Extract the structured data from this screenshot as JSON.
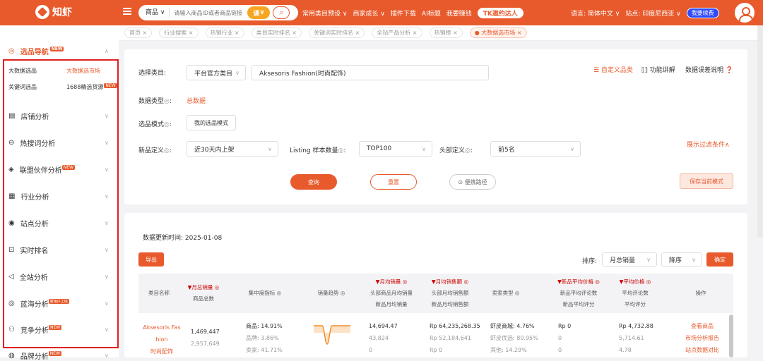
{
  "topbar": {
    "logo_text": "知虾",
    "search_type": "商品",
    "search_placeholder": "请输入商品ID或者商品链接",
    "lesson_badge": "课",
    "nav": [
      "常用类目预设 ∨",
      "商家成长 ∨",
      "插件下载",
      "AI标题",
      "我要赚钱"
    ],
    "tk_button": "TK邀约达人",
    "language": "语言: 简体中文 ∨",
    "site": "站点: 印度尼西亚 ∨",
    "renew": "我要续费"
  },
  "sidebar": {
    "section_title": "选品导航",
    "new_badge": "NEW",
    "hot_badge": "新用户上线",
    "sub_items": [
      {
        "label": "大数据选品",
        "highlight": false
      },
      {
        "label": "大数据选市场",
        "highlight": true
      },
      {
        "label": "关键词选品",
        "highlight": false
      },
      {
        "label": "1688精选货源",
        "highlight": false
      }
    ],
    "items": [
      {
        "label": "店铺分析",
        "icon": "store-icon",
        "badge": ""
      },
      {
        "label": "热搜词分析",
        "icon": "search-icon",
        "badge": ""
      },
      {
        "label": "联盟伙伴分析",
        "icon": "box-icon",
        "badge": "NEW"
      },
      {
        "label": "行业分析",
        "icon": "chart-icon",
        "badge": ""
      },
      {
        "label": "站点分析",
        "icon": "globe-icon",
        "badge": ""
      },
      {
        "label": "实时排名",
        "icon": "ranking-icon",
        "badge": ""
      },
      {
        "label": "全站分析",
        "icon": "send-icon",
        "badge": ""
      },
      {
        "label": "蓝海分析",
        "icon": "compass-icon",
        "badge": "新用户上线"
      },
      {
        "label": "竞争分析",
        "icon": "compete-icon",
        "badge": "NEW"
      },
      {
        "label": "品牌分析",
        "icon": "brand-icon",
        "badge": "NEW"
      }
    ]
  },
  "breadcrumbs": [
    "首页 ×",
    "行业搜索 ×",
    "热销行业 ×",
    "类目实时排名 ×",
    "关键词实时排名 ×",
    "全站产品分析 ×",
    "热销榜 ×",
    "● 大数据选市场 ×"
  ],
  "filters": {
    "category_label": "选择类目:",
    "category_source": "平台官方类目",
    "category_value": "Aksesoris Fashion(时尚配饰)",
    "custom_category": "☰ 自定义品类",
    "feature_guide": "功能讲解",
    "data_error_note": "数据误差说明",
    "data_type_label": "数据类型",
    "data_type_value": "总数据",
    "mode_label": "选品模式",
    "mode_value": "我的选品模式",
    "new_def_label": "新品定义",
    "new_def_value": "近30天内上架",
    "listing_label": "Listing 样本数量",
    "listing_value": "TOP100",
    "head_def_label": "头部定义",
    "head_def_value": "前5名",
    "show_filters": "展示过滤条件∧",
    "query_btn": "查询",
    "reset_btn": "重置",
    "path_btn": "便携路径",
    "save_btn": "保存当前模式"
  },
  "results": {
    "update_time": "数据更新时间: 2025-01-08",
    "export_btn": "导出",
    "sort_label": "排序:",
    "sort_by": "月总销量",
    "sort_order": "降序",
    "confirm_btn": "确定",
    "columns": [
      [
        "类目名称"
      ],
      [
        "▼月总销量 ◎",
        "商品总数"
      ],
      [
        "集中度指标 ◎"
      ],
      [
        "销量趋势 ◎"
      ],
      [
        "▼月均销量 ◎",
        "头部商品月均销量",
        "新品月均销量"
      ],
      [
        "▼月均销售额 ◎",
        "头部月均销售额",
        "新品月均销售额"
      ],
      [
        "卖家类型 ◎"
      ],
      [
        "▼新品平均价格 ◎",
        "新品平均评论数",
        "新品平均评分"
      ],
      [
        "▼平均价格 ◎",
        "平均评论数",
        "平均评分"
      ],
      [
        "操作"
      ]
    ],
    "row": {
      "category_lines": [
        "Aksesoris Fas",
        "hion",
        "时尚配饰"
      ],
      "sales": [
        "1,469,447",
        "2,957,649"
      ],
      "concentration": [
        "商品: 14.91%",
        "品牌: 3.86%",
        "卖家: 41.71%"
      ],
      "avg_sales": [
        "14,694.47",
        "43,824",
        "0"
      ],
      "avg_revenue": [
        "Rp 64,235,268.35",
        "Rp 52,184,641",
        "Rp 0"
      ],
      "seller_type": [
        "虾皮商城: 4.76%",
        "虾皮优选: 80.95%",
        "其他: 14.29%"
      ],
      "new_price": [
        "Rp 0",
        "0",
        "0"
      ],
      "avg_price": [
        "Rp 4,732.88",
        "5,714.61",
        "4.78"
      ],
      "actions": [
        "查看商品",
        "市场分析报告",
        "站点数据对比"
      ]
    }
  }
}
